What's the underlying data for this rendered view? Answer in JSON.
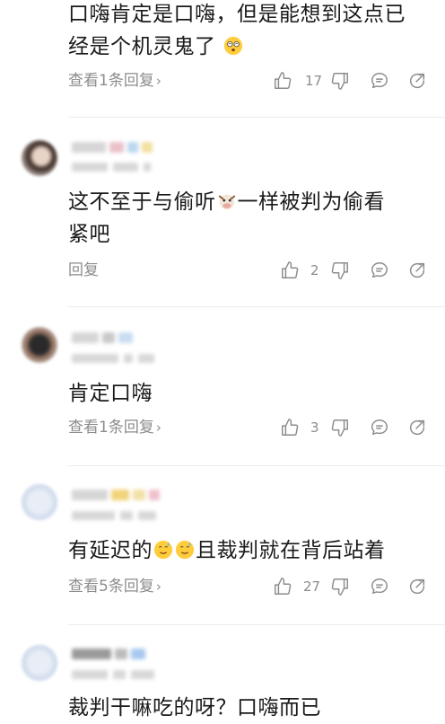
{
  "comments": [
    {
      "text_line1": "口嗨肯定是口嗨，但是能想到这点已",
      "text_line2": "经是个机灵鬼了",
      "reply_label": "查看1条回复",
      "likes": "17"
    },
    {
      "text_line1": "这不至于与偷听",
      "text_line1b": "一样被判为偷看",
      "text_line2": "紧吧",
      "reply_label": "回复",
      "likes": "2"
    },
    {
      "text_line1": "肯定口嗨",
      "reply_label": "查看1条回复",
      "likes": "3"
    },
    {
      "text_line1a": "有延迟的",
      "text_line1b": "且裁判就在背后站着",
      "reply_label": "查看5条回复",
      "likes": "27"
    },
    {
      "text_line1": "裁判干嘛吃的呀？口嗨而已"
    }
  ],
  "icons": [
    "thumbs-up-icon",
    "thumbs-down-icon",
    "comment-bubble-icon",
    "share-icon",
    "chevron-right-icon"
  ],
  "colors": {
    "text": "#1a1a1a",
    "meta": "#8c8c8c",
    "divider": "#ececec"
  }
}
